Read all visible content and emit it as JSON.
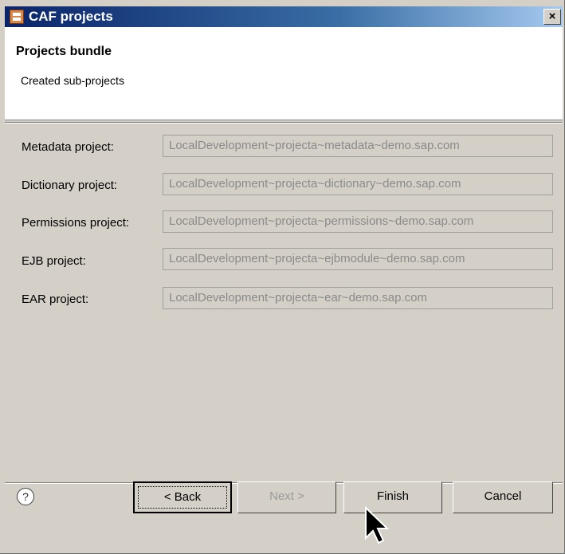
{
  "window": {
    "title": "CAF projects",
    "close_label": "×"
  },
  "header": {
    "title": "Projects bundle",
    "subtitle": "Created sub-projects"
  },
  "rows": [
    {
      "label": "Metadata project:",
      "value": "LocalDevelopment~projecta~metadata~demo.sap.com"
    },
    {
      "label": "Dictionary project:",
      "value": "LocalDevelopment~projecta~dictionary~demo.sap.com"
    },
    {
      "label": "Permissions project:",
      "value": "LocalDevelopment~projecta~permissions~demo.sap.com"
    },
    {
      "label": "EJB project:",
      "value": "LocalDevelopment~projecta~ejbmodule~demo.sap.com"
    },
    {
      "label": "EAR project:",
      "value": "LocalDevelopment~projecta~ear~demo.sap.com"
    }
  ],
  "buttons": {
    "back": "< Back",
    "next": "Next >",
    "finish": "Finish",
    "cancel": "Cancel"
  },
  "help": {
    "symbol": "?"
  },
  "icons": {
    "app": "caf-project-icon",
    "help": "help-icon",
    "close": "close-icon",
    "cursor": "mouse-pointer-icon"
  }
}
